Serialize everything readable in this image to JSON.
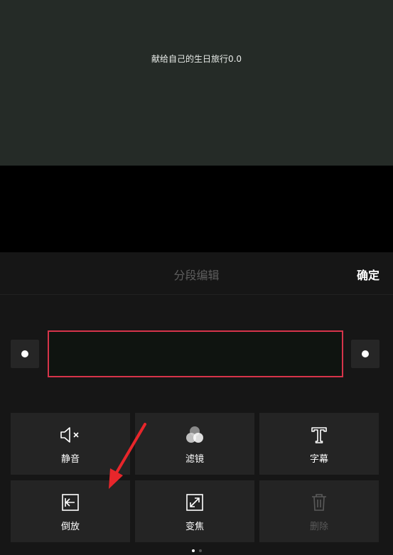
{
  "preview": {
    "caption": "献给自己的生日旅行0.0"
  },
  "panel": {
    "title": "分段编辑",
    "confirm_label": "确定"
  },
  "tools": [
    {
      "label": "静音",
      "icon": "mute-icon",
      "enabled": true
    },
    {
      "label": "滤镜",
      "icon": "filter-icon",
      "enabled": true
    },
    {
      "label": "字幕",
      "icon": "subtitle-icon",
      "enabled": true
    },
    {
      "label": "倒放",
      "icon": "reverse-icon",
      "enabled": true
    },
    {
      "label": "变焦",
      "icon": "zoom-icon",
      "enabled": true
    },
    {
      "label": "删除",
      "icon": "delete-icon",
      "enabled": false
    }
  ],
  "colors": {
    "selection_border": "#d6344a",
    "annotation_arrow": "#e8262b"
  }
}
